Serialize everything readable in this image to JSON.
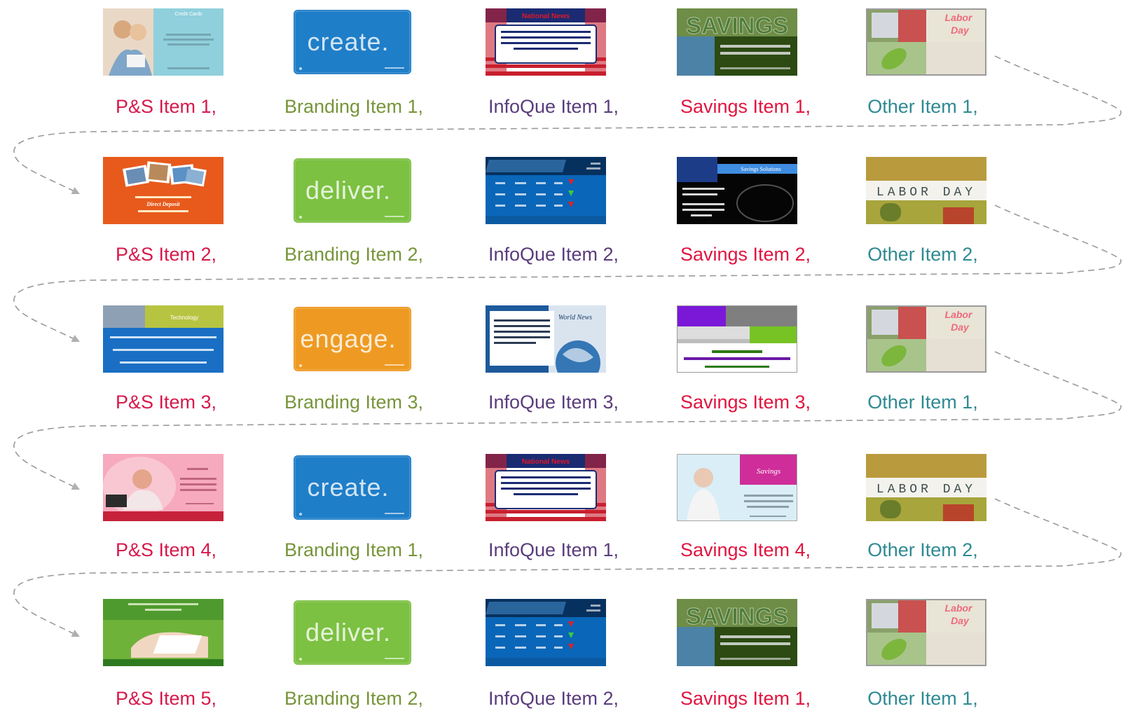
{
  "colors": {
    "ps": "#d6194b",
    "branding": "#77953a",
    "infoque": "#5a3c7c",
    "savings": "#e0153f",
    "other": "#2f8a92",
    "connector": "#9a9a9a"
  },
  "columns": [
    {
      "key": "ps",
      "color_key": "ps"
    },
    {
      "key": "branding",
      "color_key": "branding"
    },
    {
      "key": "infoque",
      "color_key": "infoque"
    },
    {
      "key": "savings",
      "color_key": "savings"
    },
    {
      "key": "other",
      "color_key": "other"
    }
  ],
  "rows": [
    {
      "cells": [
        {
          "label": "P&S Item 1,",
          "thumb": "ps-credit-cards",
          "text": "Credit Cards"
        },
        {
          "label": "Branding Item 1,",
          "thumb": "brand-create",
          "text": "create."
        },
        {
          "label": "InfoQue Item 1,",
          "thumb": "info-national-news",
          "text": "National News",
          "body": "Obama Announces Iraq Exit Plan: US president says he will withdraw all American combat troops from Iraq by end of August 2010..."
        },
        {
          "label": "Savings Item 1,",
          "thumb": "sav-savings",
          "text": "SAVINGS",
          "body": "We Have an Account That's Right for You!"
        },
        {
          "label": "Other Item 1,",
          "thumb": "other-labor-day-1",
          "text": "Labor Day"
        }
      ]
    },
    {
      "cells": [
        {
          "label": "P&S Item 2,",
          "thumb": "ps-direct-deposit",
          "text": "Direct Deposit"
        },
        {
          "label": "Branding Item 2,",
          "thumb": "brand-deliver",
          "text": "deliver."
        },
        {
          "label": "InfoQue Item 2,",
          "thumb": "info-stocks",
          "text": ""
        },
        {
          "label": "Savings Item 2,",
          "thumb": "sav-solutions",
          "text": "Savings Solutions"
        },
        {
          "label": "Other Item 2,",
          "thumb": "other-labor-day-2",
          "text": "LABOR DAY"
        }
      ]
    },
    {
      "cells": [
        {
          "label": "P&S Item 3,",
          "thumb": "ps-technology",
          "text": "Technology"
        },
        {
          "label": "Branding Item 3,",
          "thumb": "brand-engage",
          "text": "engage."
        },
        {
          "label": "InfoQue Item 3,",
          "thumb": "info-world-news",
          "text": "World News"
        },
        {
          "label": "Savings Item 3,",
          "thumb": "sav-goal",
          "text": "Whatever your goal... We have a savings account that's right for you."
        },
        {
          "label": "Other Item 1,",
          "thumb": "other-labor-day-1",
          "text": "Labor Day"
        }
      ]
    },
    {
      "cells": [
        {
          "label": "P&S Item 4,",
          "thumb": "ps-pink",
          "text": ""
        },
        {
          "label": "Branding Item 1,",
          "thumb": "brand-create",
          "text": "create."
        },
        {
          "label": "InfoQue Item 1,",
          "thumb": "info-national-news",
          "text": "National News",
          "body": "Obama Announces Iraq Exit Plan: US president says he will withdraw all American combat troops from Iraq by end of August 2010..."
        },
        {
          "label": "Savings Item 4,",
          "thumb": "sav-savings-pink",
          "text": "Savings"
        },
        {
          "label": "Other Item 2,",
          "thumb": "other-labor-day-2",
          "text": "LABOR DAY"
        }
      ]
    },
    {
      "cells": [
        {
          "label": "P&S Item 5,",
          "thumb": "ps-online",
          "text": ""
        },
        {
          "label": "Branding Item 2,",
          "thumb": "brand-deliver",
          "text": "deliver."
        },
        {
          "label": "InfoQue Item 2,",
          "thumb": "info-stocks",
          "text": ""
        },
        {
          "label": "Savings Item 1,",
          "thumb": "sav-savings",
          "text": "SAVINGS",
          "body": "We Have an Account That's Right for You!"
        },
        {
          "label": "Other Item 1,",
          "thumb": "other-labor-day-1",
          "text": "Labor Day"
        }
      ]
    }
  ]
}
